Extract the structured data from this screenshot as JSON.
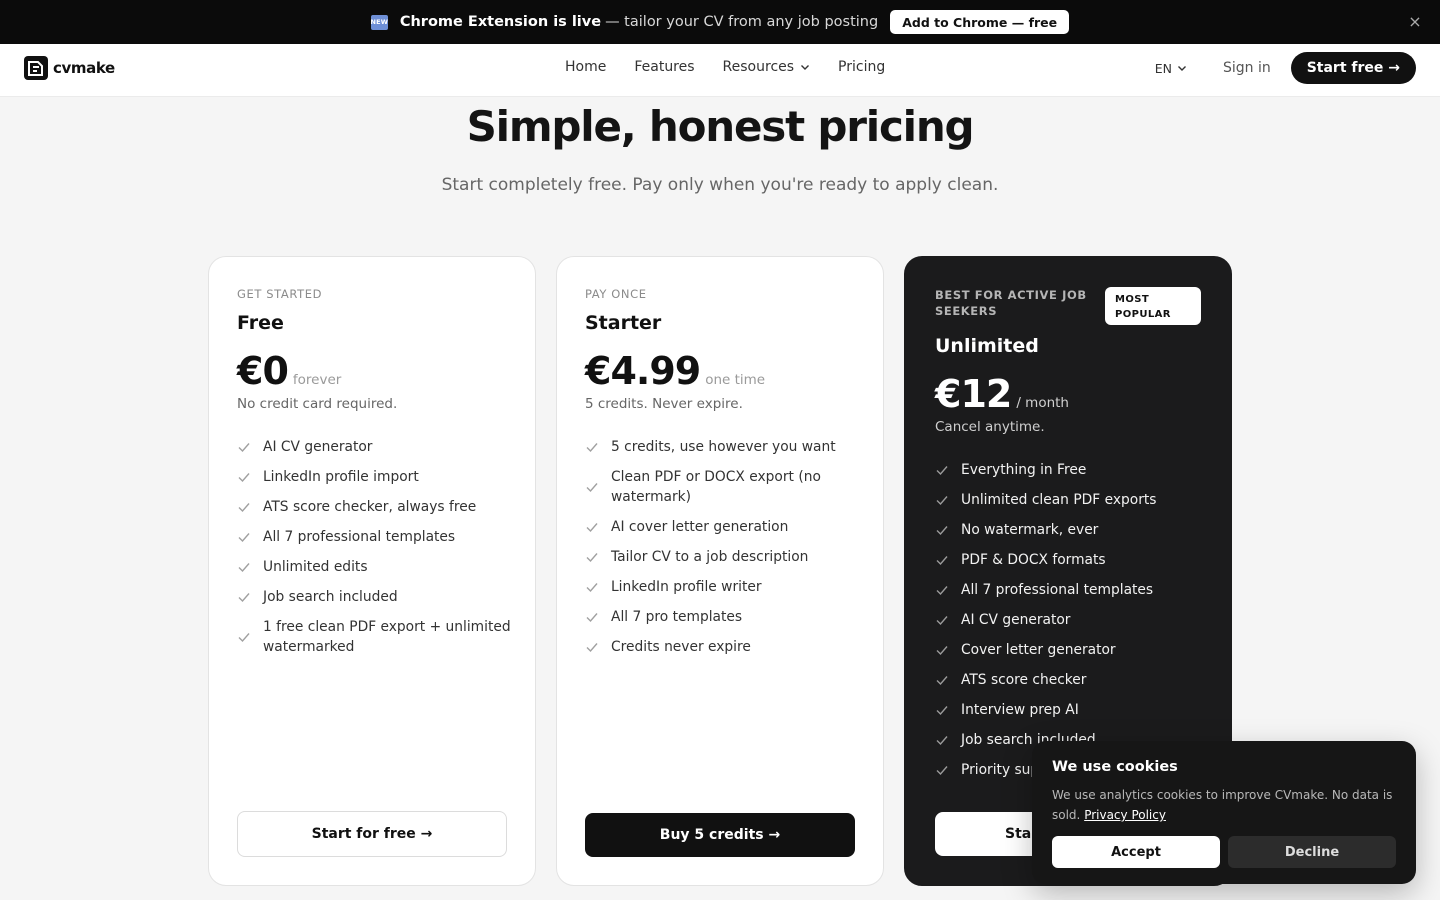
{
  "announcement": {
    "badge": "NEW",
    "strong": "Chrome Extension is live",
    "rest": "— tailor your CV from any job posting",
    "button": "Add to Chrome — free",
    "close": "×"
  },
  "nav": {
    "logo_text": "cvmake",
    "links": [
      "Home",
      "Features",
      "Resources",
      "Pricing"
    ],
    "language": "EN",
    "signin": "Sign in",
    "start": "Start free →"
  },
  "hero": {
    "title": "Simple, honest pricing",
    "subtitle": "Start completely free. Pay only when you're ready to apply clean."
  },
  "plans": [
    {
      "kicker": "GET STARTED",
      "name": "Free",
      "price": "€0",
      "period": "forever",
      "note": "No credit card required.",
      "features": [
        "AI CV generator",
        "LinkedIn profile import",
        "ATS score checker, always free",
        "All 7 professional templates",
        "Unlimited edits",
        "Job search included",
        "1 free clean PDF export + unlimited watermarked"
      ],
      "button": "Start for free →"
    },
    {
      "kicker": "PAY ONCE",
      "name": "Starter",
      "price": "€4.99",
      "period": "one time",
      "note": "5 credits. Never expire.",
      "features": [
        "5 credits, use however you want",
        "Clean PDF or DOCX export (no watermark)",
        "AI cover letter generation",
        "Tailor CV to a job description",
        "LinkedIn profile writer",
        "All 7 pro templates",
        "Credits never expire"
      ],
      "button": "Buy 5 credits →"
    },
    {
      "kicker": "BEST FOR ACTIVE JOB SEEKERS",
      "badge": "MOST POPULAR",
      "name": "Unlimited",
      "price": "€12",
      "period": "/ month",
      "note": "Cancel anytime.",
      "features": [
        "Everything in Free",
        "Unlimited clean PDF exports",
        "No watermark, ever",
        "PDF & DOCX formats",
        "All 7 professional templates",
        "AI CV generator",
        "Cover letter generator",
        "ATS score checker",
        "Interview prep AI",
        "Job search included",
        "Priority sup"
      ],
      "button": "Star"
    }
  ],
  "cookie": {
    "title": "We use cookies",
    "text": "We use analytics cookies to improve CVmake. No data is sold.",
    "link": "Privacy Policy",
    "accept": "Accept",
    "decline": "Decline"
  },
  "icons": {
    "check": "check-icon",
    "chevron": "chevron-down-icon",
    "close": "close-icon",
    "logo": "cvmake-logo"
  },
  "colors": {
    "dark": "#111111",
    "announce_bg": "#0b0b0b",
    "card_dark": "#1b1b1c",
    "page_bg": "#f5f5f5"
  }
}
